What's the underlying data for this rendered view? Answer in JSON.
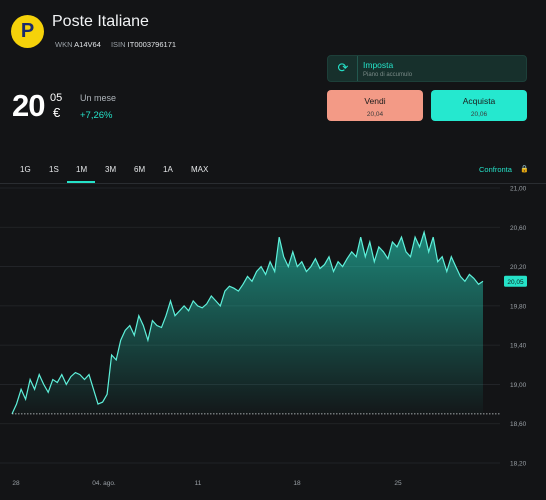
{
  "header": {
    "logo_letter": "P",
    "name": "Poste Italiane",
    "wkn_label": "WKN",
    "wkn": "A14V64",
    "isin_label": "ISIN",
    "isin": "IT0003796171"
  },
  "quote": {
    "price_int": "20",
    "price_dec": "05",
    "currency": "€",
    "period": "Un mese",
    "change": "+7,26%"
  },
  "invest": {
    "icon": "refresh-icon",
    "title": "Imposta",
    "subtitle": "Piano di accumulo"
  },
  "actions": {
    "sell_label": "Vendi",
    "sell_price": "20,04",
    "buy_label": "Acquista",
    "buy_price": "20,06"
  },
  "tabs": {
    "items": [
      "1G",
      "1S",
      "1M",
      "3M",
      "6M",
      "1A",
      "MAX"
    ],
    "active": "1M",
    "compare": "Confronta",
    "lock_icon": "lock-icon"
  },
  "colors": {
    "accent": "#25e2c8",
    "sell": "#f39a86",
    "buy": "#25e8cf",
    "background": "#131416"
  },
  "chart_data": {
    "type": "area",
    "y_tick_labels": [
      "21,00",
      "20,60",
      "20,20",
      "19,80",
      "19,40",
      "19,00",
      "18,60",
      "18,20"
    ],
    "y_ticks": [
      21.0,
      20.6,
      20.2,
      19.8,
      19.4,
      19.0,
      18.6,
      18.2
    ],
    "ylim": [
      18.2,
      21.0
    ],
    "x_tick_labels": [
      "28",
      "04. ago.",
      "11",
      "18",
      "25"
    ],
    "current_label": "20,05",
    "current_value": 20.05,
    "baseline": 18.7,
    "values": [
      18.7,
      18.8,
      18.95,
      18.85,
      19.05,
      18.95,
      19.1,
      19.0,
      18.92,
      19.05,
      19.02,
      19.1,
      19.0,
      19.08,
      19.12,
      19.1,
      19.05,
      19.1,
      18.95,
      18.8,
      18.82,
      18.9,
      19.3,
      19.25,
      19.45,
      19.55,
      19.6,
      19.5,
      19.7,
      19.6,
      19.45,
      19.65,
      19.6,
      19.58,
      19.7,
      19.85,
      19.7,
      19.75,
      19.8,
      19.75,
      19.85,
      19.8,
      19.78,
      19.82,
      19.9,
      19.85,
      19.8,
      19.95,
      20.0,
      19.98,
      19.95,
      20.02,
      20.1,
      20.05,
      20.15,
      20.2,
      20.12,
      20.25,
      20.15,
      20.5,
      20.3,
      20.2,
      20.35,
      20.2,
      20.25,
      20.15,
      20.2,
      20.28,
      20.18,
      20.22,
      20.3,
      20.15,
      20.25,
      20.2,
      20.28,
      20.35,
      20.3,
      20.5,
      20.3,
      20.45,
      20.25,
      20.4,
      20.35,
      20.28,
      20.45,
      20.4,
      20.5,
      20.35,
      20.3,
      20.5,
      20.4,
      20.55,
      20.35,
      20.5,
      20.25,
      20.3,
      20.15,
      20.3,
      20.2,
      20.1,
      20.05,
      20.12,
      20.08,
      20.02,
      20.05
    ]
  }
}
